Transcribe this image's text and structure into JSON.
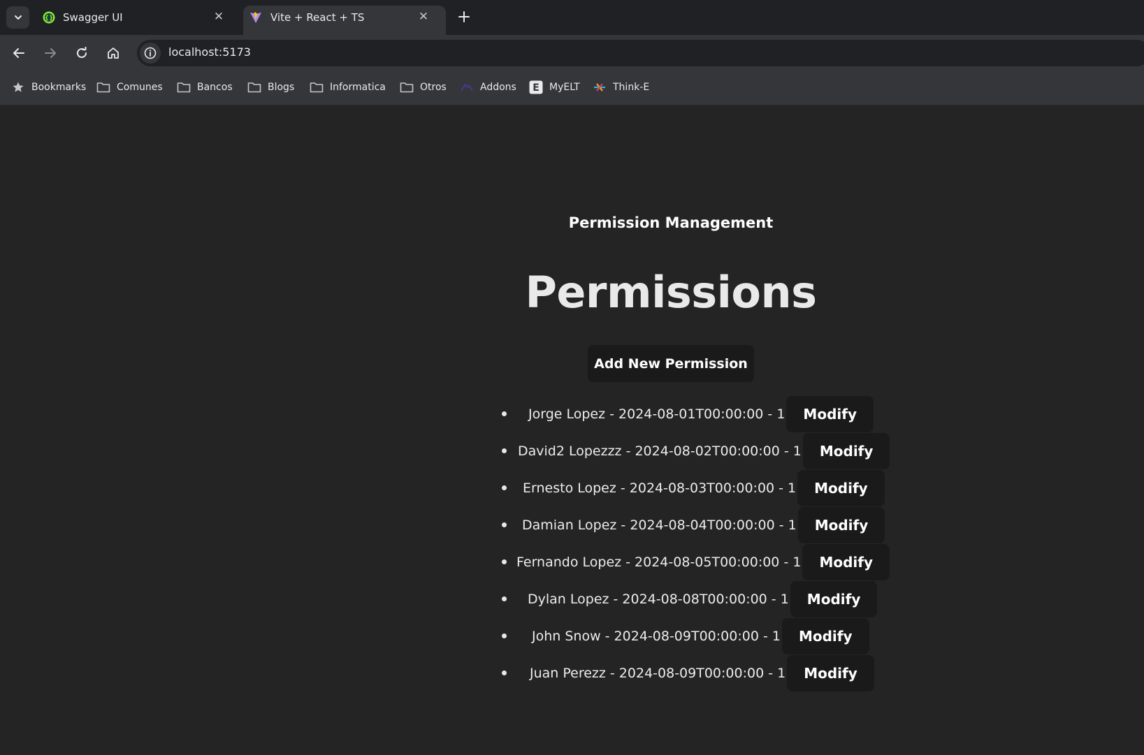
{
  "browser": {
    "tabs": [
      {
        "title": "Swagger UI",
        "active": false
      },
      {
        "title": "Vite + React + TS",
        "active": true
      }
    ],
    "url": "localhost:5173",
    "bookmarks": [
      {
        "label": "Bookmarks",
        "icon": "star-icon"
      },
      {
        "label": "Comunes",
        "icon": "folder-icon"
      },
      {
        "label": "Bancos",
        "icon": "folder-icon"
      },
      {
        "label": "Blogs",
        "icon": "folder-icon"
      },
      {
        "label": "Informatica",
        "icon": "folder-icon"
      },
      {
        "label": "Otros",
        "icon": "folder-icon"
      },
      {
        "label": "Addons",
        "icon": "addons-icon"
      },
      {
        "label": "MyELT",
        "icon": "myelt-icon"
      },
      {
        "label": "Think-E",
        "icon": "think-e-icon"
      }
    ]
  },
  "app": {
    "header": "Permission Management",
    "heading": "Permissions",
    "add_button_label": "Add New Permission",
    "modify_label": "Modify",
    "permissions": [
      {
        "text": "Jorge Lopez - 2024-08-01T00:00:00 - 1"
      },
      {
        "text": "David2 Lopezzz - 2024-08-02T00:00:00 - 1"
      },
      {
        "text": "Ernesto Lopez - 2024-08-03T00:00:00 - 1"
      },
      {
        "text": "Damian Lopez - 2024-08-04T00:00:00 - 1"
      },
      {
        "text": "Fernando Lopez - 2024-08-05T00:00:00 - 1"
      },
      {
        "text": "Dylan Lopez - 2024-08-08T00:00:00 - 1"
      },
      {
        "text": "John Snow - 2024-08-09T00:00:00 - 1"
      },
      {
        "text": "Juan Perezz - 2024-08-09T00:00:00 - 1"
      }
    ]
  },
  "colors": {
    "page_background": "#242424",
    "button_background": "#1a1a1a",
    "browser_frame": "#35363a",
    "tabstrip": "#202124"
  }
}
